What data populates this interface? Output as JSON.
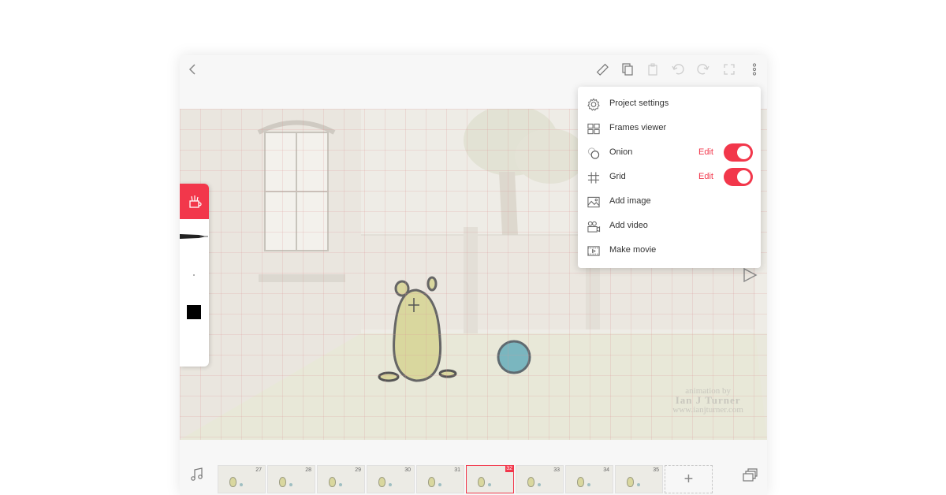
{
  "app": {
    "accent_color": "#f2374b",
    "toolbar_icons": [
      "back-icon",
      "ruler-icon",
      "copy-icon",
      "paste-icon",
      "undo-icon",
      "redo-icon",
      "fullscreen-icon",
      "more-vert-icon"
    ]
  },
  "menu": {
    "items": [
      {
        "label": "Project settings",
        "icon": "gear-icon"
      },
      {
        "label": "Frames viewer",
        "icon": "frames-grid-icon"
      },
      {
        "label": "Onion",
        "icon": "onion-icon",
        "edit": "Edit",
        "toggle": true
      },
      {
        "label": "Grid",
        "icon": "grid-icon",
        "edit": "Edit",
        "toggle": true
      },
      {
        "label": "Add image",
        "icon": "image-icon"
      },
      {
        "label": "Add video",
        "icon": "video-icon"
      },
      {
        "label": "Make movie",
        "icon": "film-icon"
      }
    ]
  },
  "canvas": {
    "credit_line1": "animation by",
    "credit_line2": "Ian J Turner",
    "credit_line3": "www.ianjturner.com"
  },
  "timeline": {
    "frames": [
      "27",
      "28",
      "29",
      "30",
      "31",
      "32",
      "33",
      "34",
      "35"
    ],
    "active_frame": "32",
    "add_label": "+"
  }
}
